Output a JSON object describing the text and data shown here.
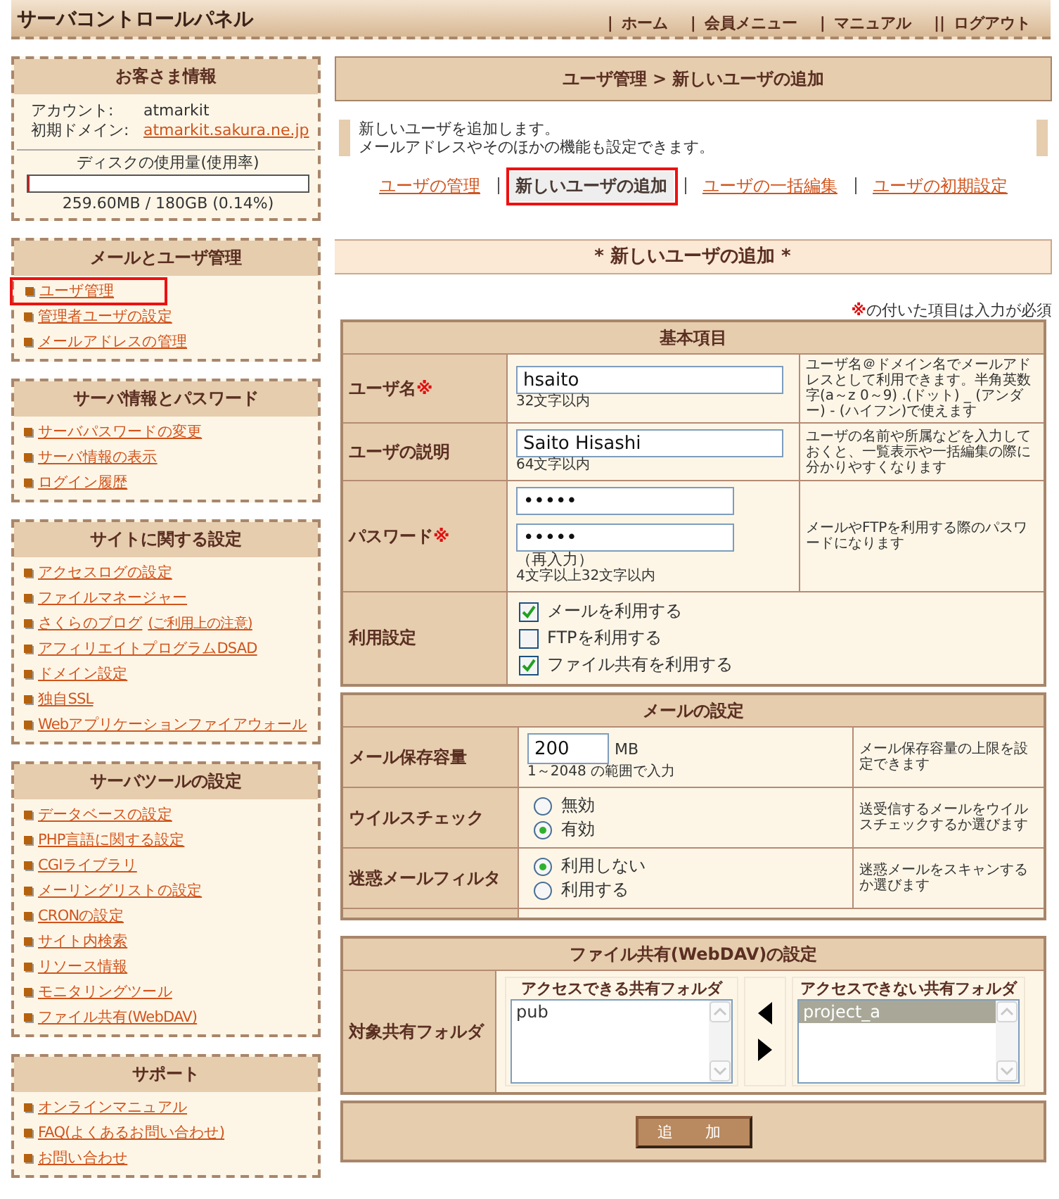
{
  "header": {
    "logo": "サーバコントロールパネル",
    "nav": [
      {
        "separator": "|",
        "label": "ホーム"
      },
      {
        "separator": "|",
        "label": "会員メニュー"
      },
      {
        "separator": "|",
        "label": "マニュアル"
      },
      {
        "separator": "||",
        "label": "ログアウト"
      }
    ]
  },
  "sidebar": {
    "account": {
      "title": "お客さま情報",
      "rows": [
        {
          "label": "アカウント:",
          "value": "atmarkit",
          "kind": "text"
        },
        {
          "label": "初期ドメイン:",
          "value": "atmarkit.sakura.ne.jp",
          "kind": "link"
        }
      ],
      "disk": {
        "label": "ディスクの使用量(使用率)",
        "level": 0.0014,
        "reading": "259.60MB / 180GB (0.14%)"
      }
    },
    "menus": [
      {
        "title": "メールとユーザ管理",
        "items": [
          {
            "label": "ユーザ管理",
            "highlighted": true
          },
          {
            "label": "管理者ユーザの設定",
            "highlighted": false
          },
          {
            "label": "メールアドレスの管理",
            "highlighted": false
          }
        ]
      },
      {
        "title": "サーバ情報とパスワード",
        "items": [
          {
            "label": "サーバパスワードの変更",
            "highlighted": false
          },
          {
            "label": "サーバ情報の表示",
            "highlighted": false
          },
          {
            "label": "ログイン履歴",
            "highlighted": false
          }
        ]
      },
      {
        "title": "サイトに関する設定",
        "items": [
          {
            "label": "アクセスログの設定",
            "highlighted": false
          },
          {
            "label": "ファイルマネージャー",
            "highlighted": false
          },
          {
            "label": "さくらのブログ",
            "note": "(ご利用上の注意)",
            "highlighted": false
          },
          {
            "label": "アフィリエイトプログラムDSAD",
            "highlighted": false
          },
          {
            "label": "ドメイン設定",
            "highlighted": false
          },
          {
            "label": "独自SSL",
            "highlighted": false
          },
          {
            "label": "Webアプリケーションファイアウォール",
            "highlighted": false
          }
        ]
      },
      {
        "title": "サーバツールの設定",
        "items": [
          {
            "label": "データベースの設定",
            "highlighted": false
          },
          {
            "label": "PHP言語に関する設定",
            "highlighted": false
          },
          {
            "label": "CGIライブラリ",
            "highlighted": false
          },
          {
            "label": "メーリングリストの設定",
            "highlighted": false
          },
          {
            "label": "CRONの設定",
            "highlighted": false
          },
          {
            "label": "サイト内検索",
            "highlighted": false
          },
          {
            "label": "リソース情報",
            "highlighted": false
          },
          {
            "label": "モニタリングツール",
            "highlighted": false
          },
          {
            "label": "ファイル共有(WebDAV)",
            "highlighted": false
          }
        ]
      },
      {
        "title": "サポート",
        "items": [
          {
            "label": "オンラインマニュアル",
            "highlighted": false
          },
          {
            "label": "FAQ(よくあるお問い合わせ)",
            "highlighted": false
          },
          {
            "label": "お問い合わせ",
            "highlighted": false
          }
        ]
      }
    ]
  },
  "breadcrumb": "ユーザ管理 > 新しいユーザの追加",
  "intro": [
    "新しいユーザを追加します。",
    "メールアドレスやそのほかの機能も設定できます。"
  ],
  "tabs": [
    {
      "label": "ユーザの管理",
      "selected": false
    },
    {
      "label": "新しいユーザの追加",
      "selected": true
    },
    {
      "label": "ユーザの一括編集",
      "selected": false
    },
    {
      "label": "ユーザの初期設定",
      "selected": false
    }
  ],
  "section_title": "* 新しいユーザの追加 *",
  "required_note": {
    "mark": "※",
    "text": "の付いた項目は入力が必須"
  },
  "basic": {
    "title": "基本項目",
    "rows": [
      {
        "kind": "text",
        "label": "ユーザ名",
        "required_mark": "※",
        "value": "hsaito",
        "hint": "32文字以内",
        "help": "ユーザ名＠ドメイン名でメールアドレスとして利用できます。半角英数字(a～z 0～9) .(ドット) _ (アンダー) - (ハイフン)で使えます"
      },
      {
        "kind": "text",
        "label": "ユーザの説明",
        "value": "Saito Hisashi",
        "hint": "64文字以内",
        "help": "ユーザの名前や所属などを入力しておくと、一覧表示や一括編集の際に分かりやすくなります"
      },
      {
        "kind": "password",
        "label": "パスワード",
        "required_mark": "※",
        "value": "•••••",
        "confirm_value": "•••••",
        "confirm_label": "（再入力）",
        "hint": "4文字以上32文字以内",
        "help": "メールやFTPを利用する際のパスワードになります"
      },
      {
        "kind": "checkboxes",
        "label": "利用設定",
        "options": [
          {
            "label": "メールを利用する",
            "checked": true
          },
          {
            "label": "FTPを利用する",
            "checked": false
          },
          {
            "label": "ファイル共有を利用する",
            "checked": true
          }
        ]
      }
    ]
  },
  "mail": {
    "title": "メールの設定",
    "rows": [
      {
        "kind": "number",
        "label": "メール保存容量",
        "value": "200",
        "unit": "MB",
        "hint": "1～2048 の範囲で入力",
        "help": "メール保存容量の上限を設定できます"
      },
      {
        "kind": "radios",
        "label": "ウイルスチェック",
        "options": [
          {
            "label": "無効",
            "selected": false
          },
          {
            "label": "有効",
            "selected": true
          }
        ],
        "help": "送受信するメールをウイルスチェックするか選びます"
      },
      {
        "kind": "radios",
        "label": "迷惑メールフィルタ",
        "options": [
          {
            "label": "利用しない",
            "selected": true
          },
          {
            "label": "利用する",
            "selected": false
          }
        ],
        "help": "迷惑メールをスキャンするか選びます"
      }
    ]
  },
  "webdav": {
    "title": "ファイル共有(WebDAV)の設定",
    "label": "対象共有フォルダ",
    "lists": [
      {
        "title": "アクセスできる共有フォルダ",
        "items": [
          {
            "label": "pub",
            "selected": false
          }
        ]
      },
      {
        "title": "アクセスできない共有フォルダ",
        "items": [
          {
            "label": "project_a",
            "selected": true
          }
        ]
      }
    ]
  },
  "submit": "追　加"
}
